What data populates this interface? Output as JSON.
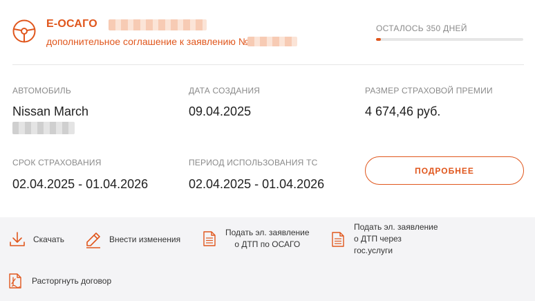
{
  "header": {
    "title": "Е-ОСАГО",
    "subtitle": "дополнительное соглашение к заявлению №",
    "steering_icon": "steering-wheel-icon",
    "accent_color": "#e0561c"
  },
  "remaining": {
    "label": "ОСТАЛОСЬ 350 ДНЕЙ",
    "progress_fraction": 0.035
  },
  "fields": {
    "car": {
      "label": "АВТОМОБИЛЬ",
      "value": "Nissan March"
    },
    "created": {
      "label": "ДАТА СОЗДАНИЯ",
      "value": "09.04.2025"
    },
    "premium": {
      "label": "РАЗМЕР СТРАХОВОЙ ПРЕМИИ",
      "value": "4 674,46 руб."
    },
    "term": {
      "label": "СРОК СТРАХОВАНИЯ",
      "value": "02.04.2025 - 01.04.2026"
    },
    "usage": {
      "label": "ПЕРИОД ИСПОЛЬЗОВАНИЯ ТС",
      "value": "02.04.2025 - 01.04.2026"
    }
  },
  "details_button": {
    "label": "ПОДРОБНЕЕ"
  },
  "actions": {
    "download": {
      "label": "Скачать",
      "icon": "download-icon"
    },
    "edit": {
      "label": "Внести изменения",
      "icon": "pencil-icon"
    },
    "claim_osago": {
      "line1": "Подать эл. заявление",
      "line2": "о ДТП по ОСАГО",
      "icon": "document-icon"
    },
    "claim_gos": {
      "line1": "Подать эл. заявление",
      "line2": "о ДТП через",
      "line3": "гос.услуги",
      "icon": "document-icon"
    },
    "terminate": {
      "label": "Расторгнуть договор",
      "icon": "terminate-document-icon"
    }
  }
}
